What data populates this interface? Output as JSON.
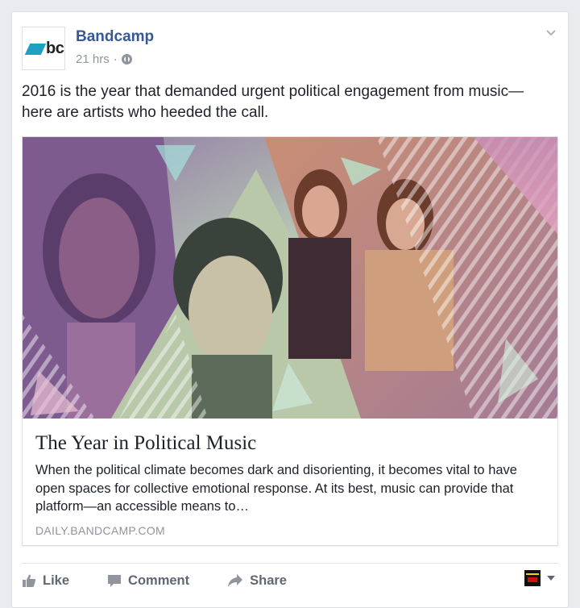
{
  "post": {
    "page_name": "Bandcamp",
    "avatar_text": "bc",
    "timestamp": "21 hrs",
    "separator": "·",
    "privacy_icon": "globe-icon",
    "text": "2016 is the year that demanded urgent political engagement from music—here are artists who heeded the call."
  },
  "link_card": {
    "title": "The Year in Political Music",
    "description": "When the political climate becomes dark and disorienting, it becomes vital to have open spaces for collective emotional response. At its best, music can provide that platform—an accessible means to…",
    "domain": "DAILY.BANDCAMP.COM"
  },
  "actions": {
    "like_label": "Like",
    "comment_label": "Comment",
    "share_label": "Share",
    "like_icon": "thumbs-up-icon",
    "comment_icon": "comment-icon",
    "share_icon": "share-arrow-icon"
  },
  "colors": {
    "page_name": "#365899",
    "action_text": "#616770",
    "meta_text": "#90949c",
    "bandcamp_brand": "#1da0c3"
  }
}
